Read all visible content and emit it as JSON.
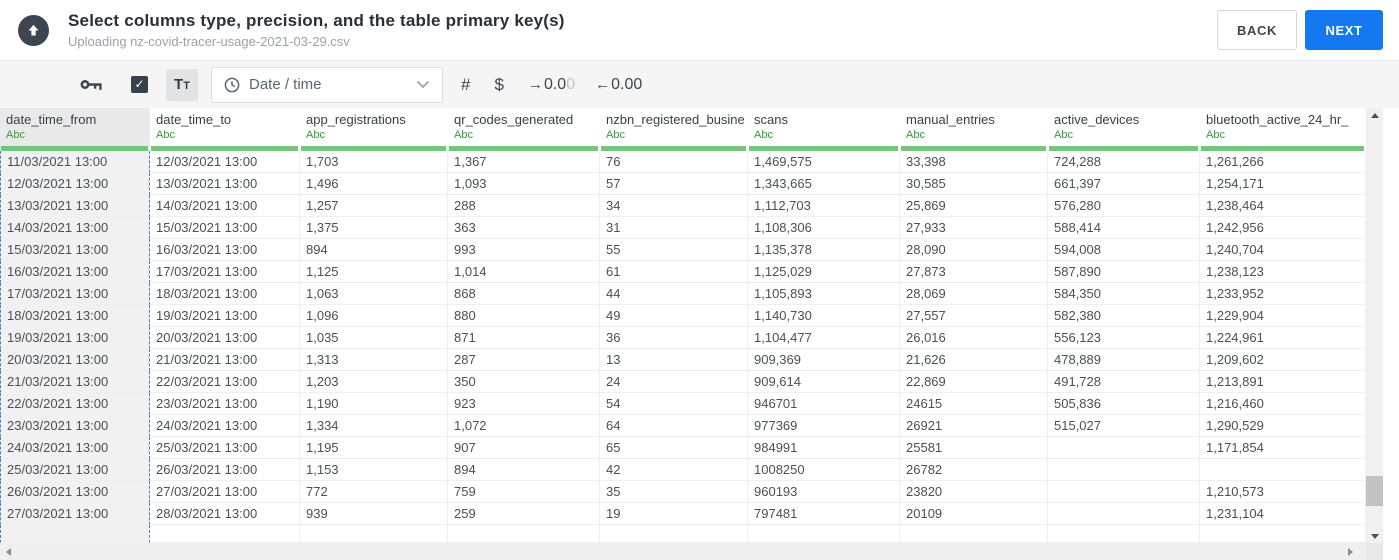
{
  "header": {
    "title": "Select columns type, precision, and the table primary key(s)",
    "subtitle": "Uploading nz-covid-tracer-usage-2021-03-29.csv",
    "back_label": "BACK",
    "next_label": "NEXT"
  },
  "toolbar": {
    "text_type_label": "Tt",
    "type_dropdown_value": "Date / time",
    "number_type_label": "#",
    "currency_type_label": "$",
    "inc_decimal_main": "0.0",
    "inc_decimal_faded": "0",
    "dec_decimal_value": "0.00"
  },
  "icons": {
    "check": "✓",
    "arrow_right": "→",
    "arrow_left": "←"
  },
  "table": {
    "type_label": "Abc",
    "columns": [
      {
        "name": "date_time_from",
        "selected": true
      },
      {
        "name": "date_time_to"
      },
      {
        "name": "app_registrations"
      },
      {
        "name": "qr_codes_generated"
      },
      {
        "name": "nzbn_registered_busine"
      },
      {
        "name": "scans"
      },
      {
        "name": "manual_entries"
      },
      {
        "name": "active_devices"
      },
      {
        "name": "bluetooth_active_24_hr_"
      }
    ],
    "rows": [
      [
        "11/03/2021 13:00",
        "12/03/2021 13:00",
        "1,703",
        "1,367",
        "76",
        "1,469,575",
        "33,398",
        "724,288",
        "1,261,266"
      ],
      [
        "12/03/2021 13:00",
        "13/03/2021 13:00",
        "1,496",
        "1,093",
        "57",
        "1,343,665",
        "30,585",
        "661,397",
        "1,254,171"
      ],
      [
        "13/03/2021 13:00",
        "14/03/2021 13:00",
        "1,257",
        "288",
        "34",
        "1,112,703",
        "25,869",
        "576,280",
        "1,238,464"
      ],
      [
        "14/03/2021 13:00",
        "15/03/2021 13:00",
        "1,375",
        "363",
        "31",
        "1,108,306",
        "27,933",
        "588,414",
        "1,242,956"
      ],
      [
        "15/03/2021 13:00",
        "16/03/2021 13:00",
        "894",
        "993",
        "55",
        "1,135,378",
        "28,090",
        "594,008",
        "1,240,704"
      ],
      [
        "16/03/2021 13:00",
        "17/03/2021 13:00",
        "1,125",
        "1,014",
        "61",
        "1,125,029",
        "27,873",
        "587,890",
        "1,238,123"
      ],
      [
        "17/03/2021 13:00",
        "18/03/2021 13:00",
        "1,063",
        "868",
        "44",
        "1,105,893",
        "28,069",
        "584,350",
        "1,233,952"
      ],
      [
        "18/03/2021 13:00",
        "19/03/2021 13:00",
        "1,096",
        "880",
        "49",
        "1,140,730",
        "27,557",
        "582,380",
        "1,229,904"
      ],
      [
        "19/03/2021 13:00",
        "20/03/2021 13:00",
        "1,035",
        "871",
        "36",
        "1,104,477",
        "26,016",
        "556,123",
        "1,224,961"
      ],
      [
        "20/03/2021 13:00",
        "21/03/2021 13:00",
        "1,313",
        "287",
        "13",
        "909,369",
        "21,626",
        "478,889",
        "1,209,602"
      ],
      [
        "21/03/2021 13:00",
        "22/03/2021 13:00",
        "1,203",
        "350",
        "24",
        "909,614",
        "22,869",
        "491,728",
        "1,213,891"
      ],
      [
        "22/03/2021 13:00",
        "23/03/2021 13:00",
        "1,190",
        "923",
        "54",
        "946701",
        "24615",
        "505,836",
        "1,216,460"
      ],
      [
        "23/03/2021 13:00",
        "24/03/2021 13:00",
        "1,334",
        "1,072",
        "64",
        "977369",
        "26921",
        "515,027",
        "1,290,529"
      ],
      [
        "24/03/2021 13:00",
        "25/03/2021 13:00",
        "1,195",
        "907",
        "65",
        "984991",
        "25581",
        "",
        "1,171,854"
      ],
      [
        "25/03/2021 13:00",
        "26/03/2021 13:00",
        "1,153",
        "894",
        "42",
        "1008250",
        "26782",
        "",
        ""
      ],
      [
        "26/03/2021 13:00",
        "27/03/2021 13:00",
        "772",
        "759",
        "35",
        "960193",
        "23820",
        "",
        "1,210,573"
      ],
      [
        "27/03/2021 13:00",
        "28/03/2021 13:00",
        "939",
        "259",
        "19",
        "797481",
        "20109",
        "",
        "1,231,104"
      ]
    ]
  },
  "colors": {
    "accent": "#1478f0",
    "greenbar": "#77c677",
    "typegreen": "#33a033",
    "selblue": "#4b7bd5",
    "icondark": "#3c4450"
  }
}
